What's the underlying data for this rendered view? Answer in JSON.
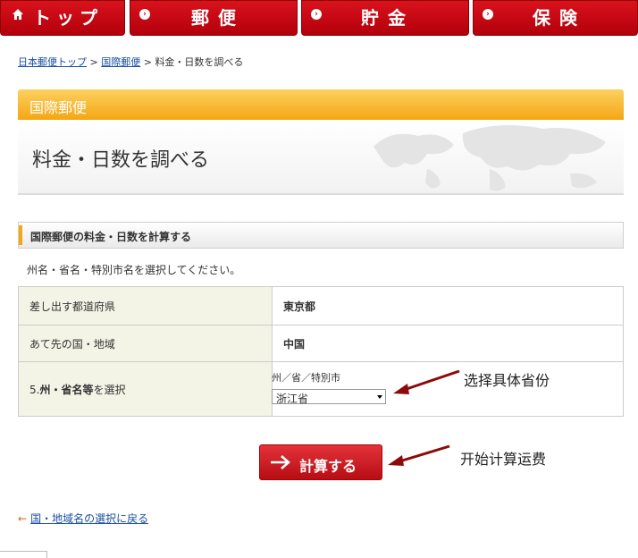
{
  "nav": {
    "top": "トップ",
    "mail": "郵便",
    "savings": "貯金",
    "insurance": "保険"
  },
  "breadcrumb": {
    "home": "日本郵便トップ",
    "intl": "国際郵便",
    "current": "料金・日数を調べる",
    "sep": ">"
  },
  "header": {
    "category": "国際郵便",
    "title": "料金・日数を調べる"
  },
  "section": {
    "title": "国際郵便の料金・日数を計算する",
    "instruction": "州名・省名・特別市名を選択してください。"
  },
  "form": {
    "rows": [
      {
        "label": "差し出す都道府県",
        "value": "東京都"
      },
      {
        "label": "あて先の国・地域",
        "value": "中国"
      }
    ],
    "state_label_prefix": "5.",
    "state_label_bold": "州・省名等",
    "state_label_suffix": "を選択",
    "select_caption": "州／省／特別市",
    "select_value": "浙江省"
  },
  "annotations": {
    "select_note": "选择具体省份",
    "calc_note": "开始计算运费"
  },
  "button": {
    "calc_label": "計算する"
  },
  "back_link": "国・地域名の選択に戻る"
}
